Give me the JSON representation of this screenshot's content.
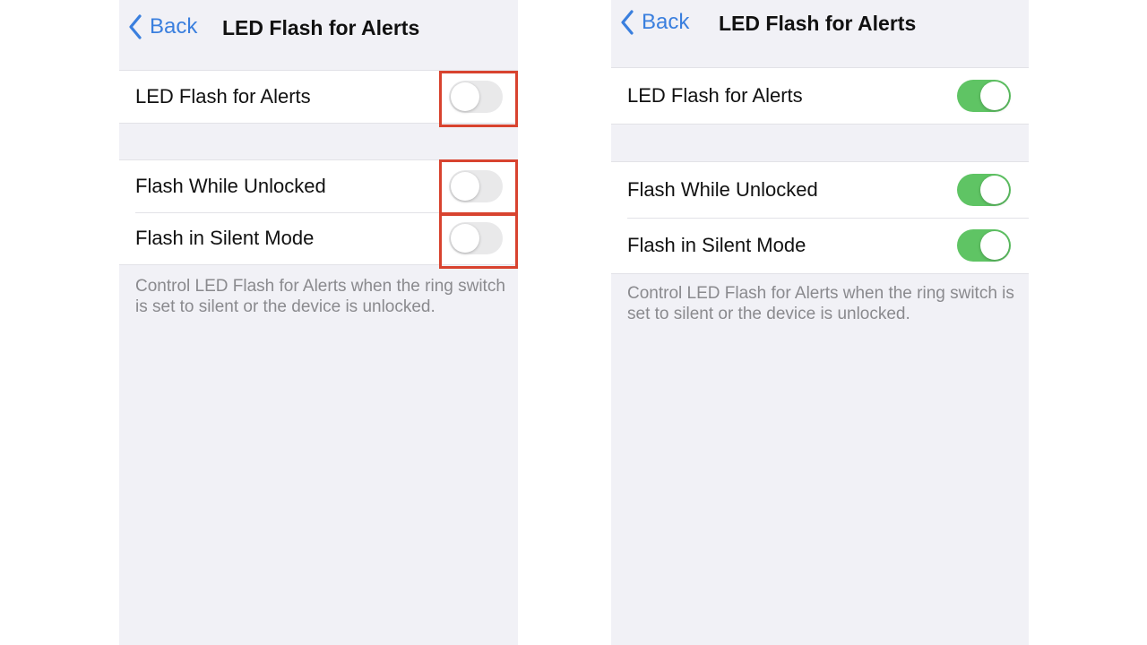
{
  "screens": [
    {
      "state": "before",
      "nav": {
        "back_label": "Back",
        "title": "LED Flash for Alerts"
      },
      "main_toggle": {
        "label": "LED Flash for Alerts",
        "on": false
      },
      "options": [
        {
          "label": "Flash While Unlocked",
          "on": false
        },
        {
          "label": "Flash in Silent Mode",
          "on": false
        }
      ],
      "footnote": "Control LED Flash for Alerts when the ring switch is set to silent or the device is unlocked.",
      "highlighted_toggles": true
    },
    {
      "state": "after",
      "nav": {
        "back_label": "Back",
        "title": "LED Flash for Alerts"
      },
      "main_toggle": {
        "label": "LED Flash for Alerts",
        "on": true
      },
      "options": [
        {
          "label": "Flash While Unlocked",
          "on": true
        },
        {
          "label": "Flash in Silent Mode",
          "on": true
        }
      ],
      "footnote": "Control LED Flash for Alerts when the ring switch is set to silent or the device is unlocked.",
      "highlighted_toggles": false
    }
  ],
  "colors": {
    "accent_blue": "#3a7fde",
    "toggle_on": "#5fc464",
    "toggle_off": "#e9e9ea",
    "highlight_red": "#d8432f"
  }
}
